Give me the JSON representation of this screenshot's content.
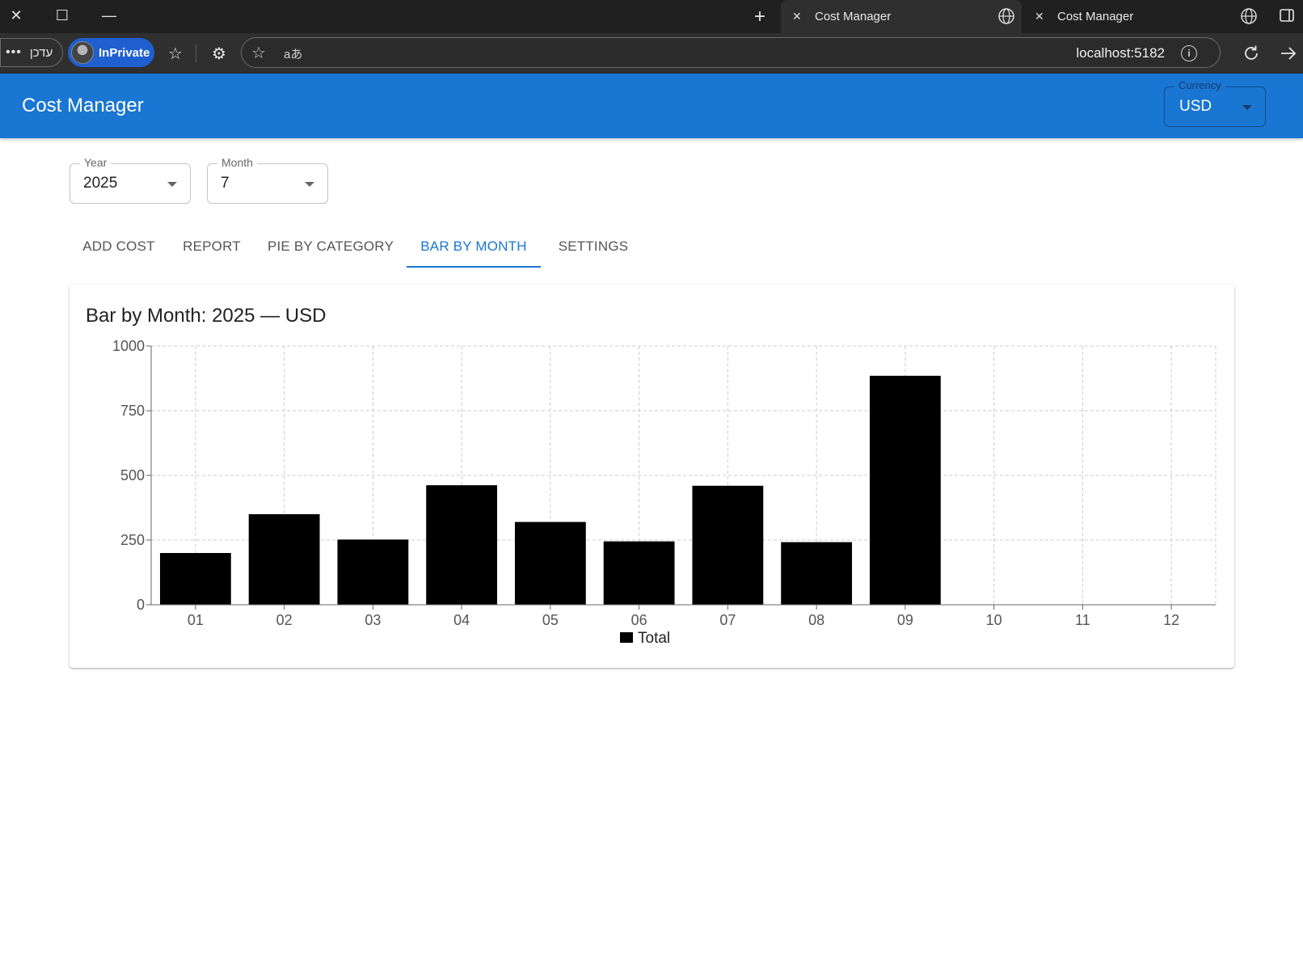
{
  "browser": {
    "tabs": [
      {
        "title": "Cost Manager",
        "active": true
      },
      {
        "title": "Cost Manager",
        "active": false
      }
    ],
    "more_label": "עדכן",
    "inprivate_label": "InPrivate",
    "address_url": "localhost:5182",
    "translate_glyph": "aあ"
  },
  "appbar": {
    "title": "Cost Manager",
    "currency": {
      "label": "Currency",
      "value": "USD"
    },
    "colors": {
      "primary": "#1976d2"
    }
  },
  "filters": {
    "year": {
      "label": "Year",
      "value": "2025"
    },
    "month": {
      "label": "Month",
      "value": "7"
    }
  },
  "nav": {
    "tabs": [
      "ADD COST",
      "REPORT",
      "PIE BY CATEGORY",
      "BAR BY MONTH",
      "SETTINGS"
    ],
    "active_tab": "BAR BY MONTH"
  },
  "card": {
    "title": "Bar by Month: 2025 — USD"
  },
  "chart_data": {
    "type": "bar",
    "title": "Bar by Month: 2025 — USD",
    "xlabel": "",
    "ylabel": "",
    "categories": [
      "01",
      "02",
      "03",
      "04",
      "05",
      "06",
      "07",
      "08",
      "09",
      "10",
      "11",
      "12"
    ],
    "series": [
      {
        "name": "Total",
        "color": "#000000",
        "values": [
          200,
          350,
          252,
          462,
          320,
          245,
          460,
          242,
          885,
          0,
          0,
          0
        ]
      }
    ],
    "ylim": [
      0,
      1000
    ],
    "yticks": [
      0,
      250,
      500,
      750,
      1000
    ],
    "grid": true,
    "legend": "bottom-center"
  }
}
